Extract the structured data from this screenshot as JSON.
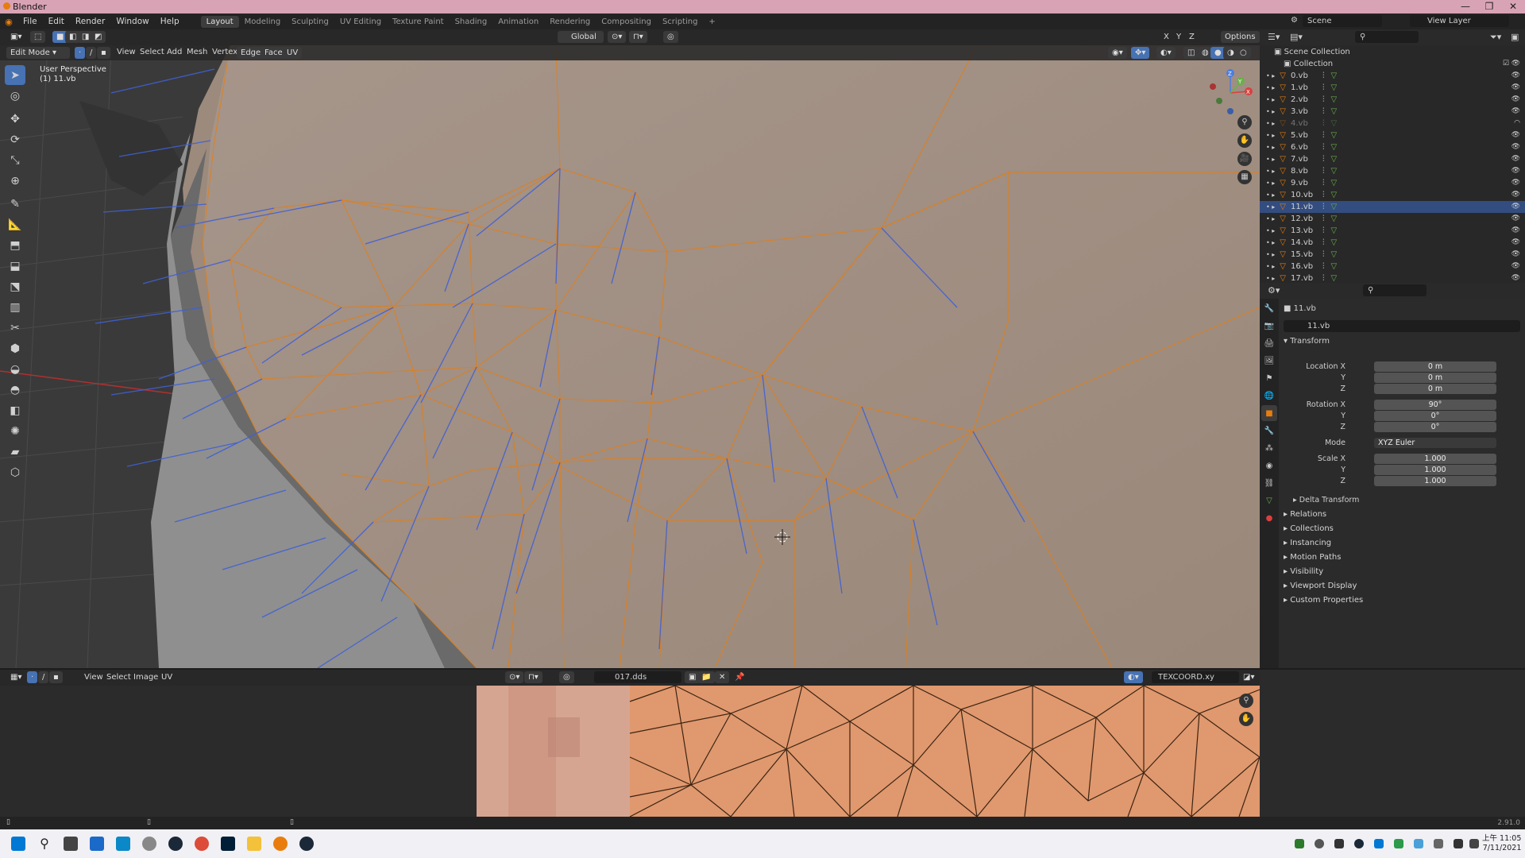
{
  "window": {
    "title": "Blender"
  },
  "menu": [
    "File",
    "Edit",
    "Render",
    "Window",
    "Help"
  ],
  "workspaces": [
    "Layout",
    "Modeling",
    "Sculpting",
    "UV Editing",
    "Texture Paint",
    "Shading",
    "Animation",
    "Rendering",
    "Compositing",
    "Scripting"
  ],
  "active_workspace": "Layout",
  "scene": {
    "name": "Scene",
    "view_layer": "View Layer"
  },
  "viewport": {
    "mode": "Edit Mode",
    "transform_orientation": "Global",
    "options_label": "Options",
    "menus": [
      "View",
      "Select",
      "Add",
      "Mesh",
      "Vertex",
      "Edge",
      "Face",
      "UV"
    ],
    "perspective": "User Perspective",
    "object_info": "(1) 11.vb",
    "axis_labels": [
      "X",
      "Y",
      "Z"
    ]
  },
  "outliner": {
    "scene_collection": "Scene Collection",
    "collection": "Collection",
    "objects": [
      "0.vb",
      "1.vb",
      "2.vb",
      "3.vb",
      "4.vb",
      "5.vb",
      "6.vb",
      "7.vb",
      "8.vb",
      "9.vb",
      "10.vb",
      "11.vb",
      "12.vb",
      "13.vb",
      "14.vb",
      "15.vb",
      "16.vb",
      "17.vb"
    ],
    "selected": "11.vb",
    "hidden": "4.vb"
  },
  "properties": {
    "object_name": "11.vb",
    "data_name": "11.vb",
    "transform_title": "Transform",
    "location": {
      "label": "Location X",
      "x": "0 m",
      "y": "0 m",
      "z": "0 m"
    },
    "rotation": {
      "label": "Rotation X",
      "x": "90°",
      "y": "0°",
      "z": "0°"
    },
    "mode": {
      "label": "Mode",
      "value": "XYZ Euler"
    },
    "scale": {
      "label": "Scale X",
      "x": "1.000",
      "y": "1.000",
      "z": "1.000"
    },
    "y_label": "Y",
    "z_label": "Z",
    "delta_transform": "Delta Transform",
    "panels": [
      "Relations",
      "Collections",
      "Instancing",
      "Motion Paths",
      "Visibility",
      "Viewport Display",
      "Custom Properties"
    ]
  },
  "image_editor": {
    "menus": [
      "View",
      "Select",
      "Image",
      "UV"
    ],
    "image_name": "017.dds",
    "uv_map": "TEXCOORD.xy"
  },
  "status": {
    "version": "2.91.0"
  },
  "taskbar": {
    "time": "上午 11:05",
    "date": "7/11/2021"
  },
  "colors": {
    "selection": "#4772b3",
    "orange_wire": "#e87d0d",
    "normal_blue": "#3f60d6"
  }
}
